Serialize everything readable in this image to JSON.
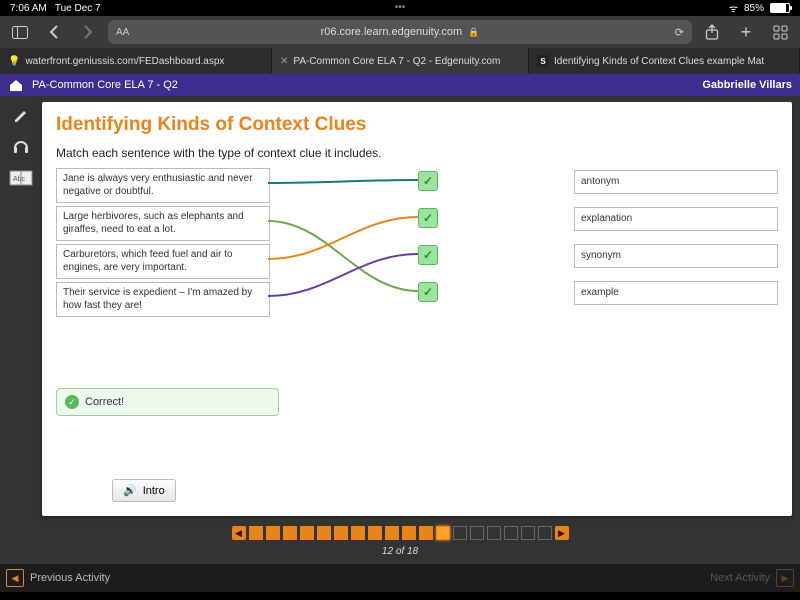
{
  "status": {
    "time": "7:06 AM",
    "date": "Tue Dec 7",
    "battery": "85%"
  },
  "address": {
    "host": "r06.core.learn.edgenuity.com",
    "aa_label": "AA"
  },
  "tabs": [
    {
      "label": "waterfront.geniussis.com/FEDashboard.aspx"
    },
    {
      "label": "PA-Common Core ELA 7 - Q2 - Edgenuity.com"
    },
    {
      "label": "Identifying Kinds of Context Clues example Mat"
    }
  ],
  "breadcrumb": {
    "course": "PA-Common Core ELA 7 - Q2",
    "user": "Gabbrielle Villars"
  },
  "page": {
    "title": "Identifying Kinds of Context Clues",
    "instruction": "Match each sentence with the type of context clue it includes.",
    "left": [
      "Jane is always very enthusiastic and never negative or doubtful.",
      "Large herbivores, such as elephants and giraffes, need to eat a lot.",
      "Carburetors, which feed fuel and air to engines, are very important.",
      "Their service is expedient – I'm amazed by how fast they are!"
    ],
    "right": [
      "antonym",
      "explanation",
      "synonym",
      "example"
    ],
    "feedback": "Correct!",
    "intro_label": "Intro"
  },
  "pager": {
    "current": 12,
    "total": 18,
    "label": "12 of 18"
  },
  "footer": {
    "prev": "Previous Activity",
    "next": "Next Activity"
  }
}
